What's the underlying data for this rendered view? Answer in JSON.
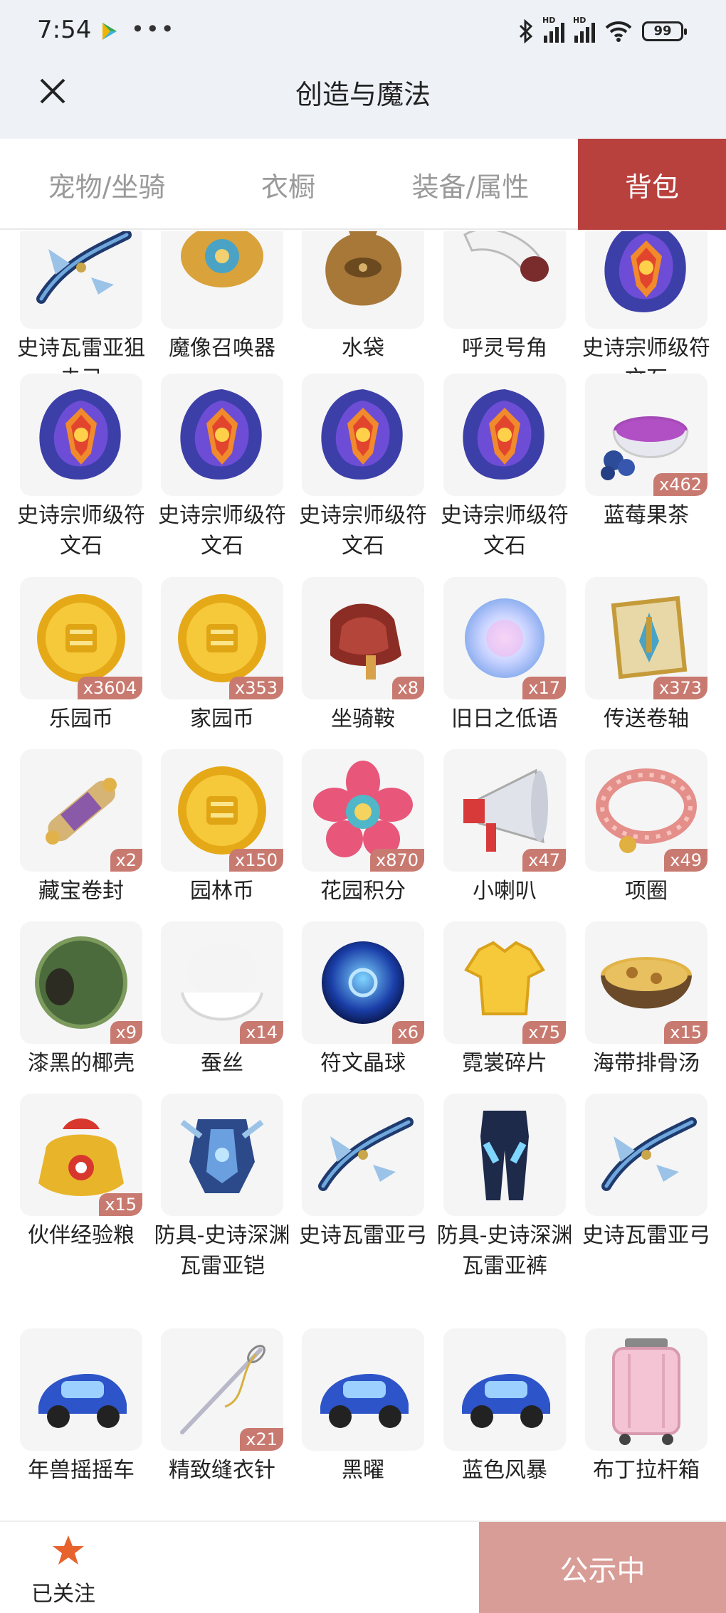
{
  "status_bar": {
    "time": "7:54",
    "more": "•••",
    "battery": "99",
    "signal_label": "HD"
  },
  "header": {
    "title": "创造与魔法",
    "close_icon": "close-icon"
  },
  "tabs": [
    {
      "label": "宠物/坐骑",
      "active": false
    },
    {
      "label": "衣橱",
      "active": false
    },
    {
      "label": "装备/属性",
      "active": false
    },
    {
      "label": "背包",
      "active": true
    }
  ],
  "items": [
    {
      "name": "史诗瓦雷亚狙击弓",
      "count": "",
      "icon": "bow"
    },
    {
      "name": "魔像召唤器",
      "count": "",
      "icon": "golem-summoner"
    },
    {
      "name": "水袋",
      "count": "",
      "icon": "water-bag"
    },
    {
      "name": "呼灵号角",
      "count": "",
      "icon": "horn"
    },
    {
      "name": "史诗宗师级符文石",
      "count": "",
      "icon": "rune"
    },
    {
      "name": "史诗宗师级符文石",
      "count": "",
      "icon": "rune"
    },
    {
      "name": "史诗宗师级符文石",
      "count": "",
      "icon": "rune"
    },
    {
      "name": "史诗宗师级符文石",
      "count": "",
      "icon": "rune"
    },
    {
      "name": "史诗宗师级符文石",
      "count": "",
      "icon": "rune"
    },
    {
      "name": "蓝莓果茶",
      "count": "x462",
      "icon": "tea"
    },
    {
      "name": "乐园币",
      "count": "x3604",
      "icon": "coin"
    },
    {
      "name": "家园币",
      "count": "x353",
      "icon": "coin"
    },
    {
      "name": "坐骑鞍",
      "count": "x8",
      "icon": "saddle"
    },
    {
      "name": "旧日之低语",
      "count": "x17",
      "icon": "orb-light"
    },
    {
      "name": "传送卷轴",
      "count": "x373",
      "icon": "scroll"
    },
    {
      "name": "藏宝卷封",
      "count": "x2",
      "icon": "treasure-scroll"
    },
    {
      "name": "园林币",
      "count": "x150",
      "icon": "coin"
    },
    {
      "name": "花园积分",
      "count": "x870",
      "icon": "flower"
    },
    {
      "name": "小喇叭",
      "count": "x47",
      "icon": "megaphone"
    },
    {
      "name": "项圈",
      "count": "x49",
      "icon": "collar"
    },
    {
      "name": "漆黑的椰壳",
      "count": "x9",
      "icon": "coconut"
    },
    {
      "name": "蚕丝",
      "count": "x14",
      "icon": "silk"
    },
    {
      "name": "符文晶球",
      "count": "x6",
      "icon": "orb-blue"
    },
    {
      "name": "霓裳碎片",
      "count": "x75",
      "icon": "shirt"
    },
    {
      "name": "海带排骨汤",
      "count": "x15",
      "icon": "soup"
    },
    {
      "name": "伙伴经验粮",
      "count": "x15",
      "icon": "food-bag"
    },
    {
      "name": "防具-史诗深渊瓦雷亚铠",
      "count": "",
      "icon": "armor"
    },
    {
      "name": "史诗瓦雷亚弓",
      "count": "",
      "icon": "bow"
    },
    {
      "name": "防具-史诗深渊瓦雷亚裤",
      "count": "",
      "icon": "pants"
    },
    {
      "name": "史诗瓦雷亚弓",
      "count": "",
      "icon": "bow"
    },
    {
      "name": "年兽摇摇车",
      "count": "",
      "icon": "car"
    },
    {
      "name": "精致缝衣针",
      "count": "x21",
      "icon": "needle"
    },
    {
      "name": "黑曜",
      "count": "",
      "icon": "car"
    },
    {
      "name": "蓝色风暴",
      "count": "",
      "icon": "car"
    },
    {
      "name": "布丁拉杆箱",
      "count": "",
      "icon": "suitcase"
    }
  ],
  "colors": {
    "accent": "#b8413d",
    "badge": "#c97a70",
    "announce_bg": "#d89d97",
    "star": "#e8622d"
  },
  "bottom": {
    "follow_label": "已关注",
    "announce_label": "公示中",
    "star_icon": "star-icon"
  }
}
